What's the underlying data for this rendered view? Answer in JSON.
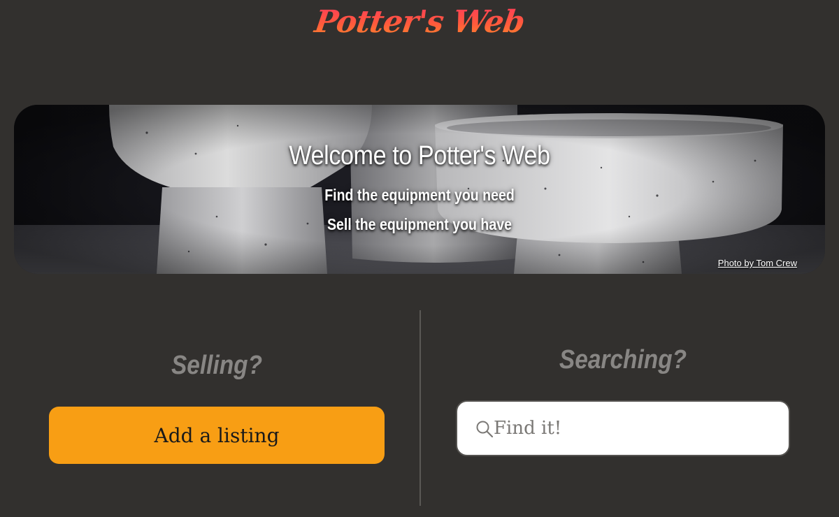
{
  "brand": {
    "logo_text": "Potter's Web",
    "logo_gradient": [
      "#ff3b5a",
      "#ff5a3c",
      "#ff8a2a"
    ]
  },
  "hero": {
    "title": "Welcome to Potter's Web",
    "subtitle_1": "Find the equipment you need",
    "subtitle_2": "Sell the equipment you have",
    "photo_credit": "Photo by Tom Crew"
  },
  "selling": {
    "heading": "Selling?",
    "button_label": "Add a listing",
    "button_color": "#f89e14"
  },
  "searching": {
    "heading": "Searching?",
    "placeholder": "Find it!",
    "icon": "search-icon"
  },
  "colors": {
    "background": "#32302e",
    "heading_gray": "#888684",
    "divider": "#5a5855"
  }
}
